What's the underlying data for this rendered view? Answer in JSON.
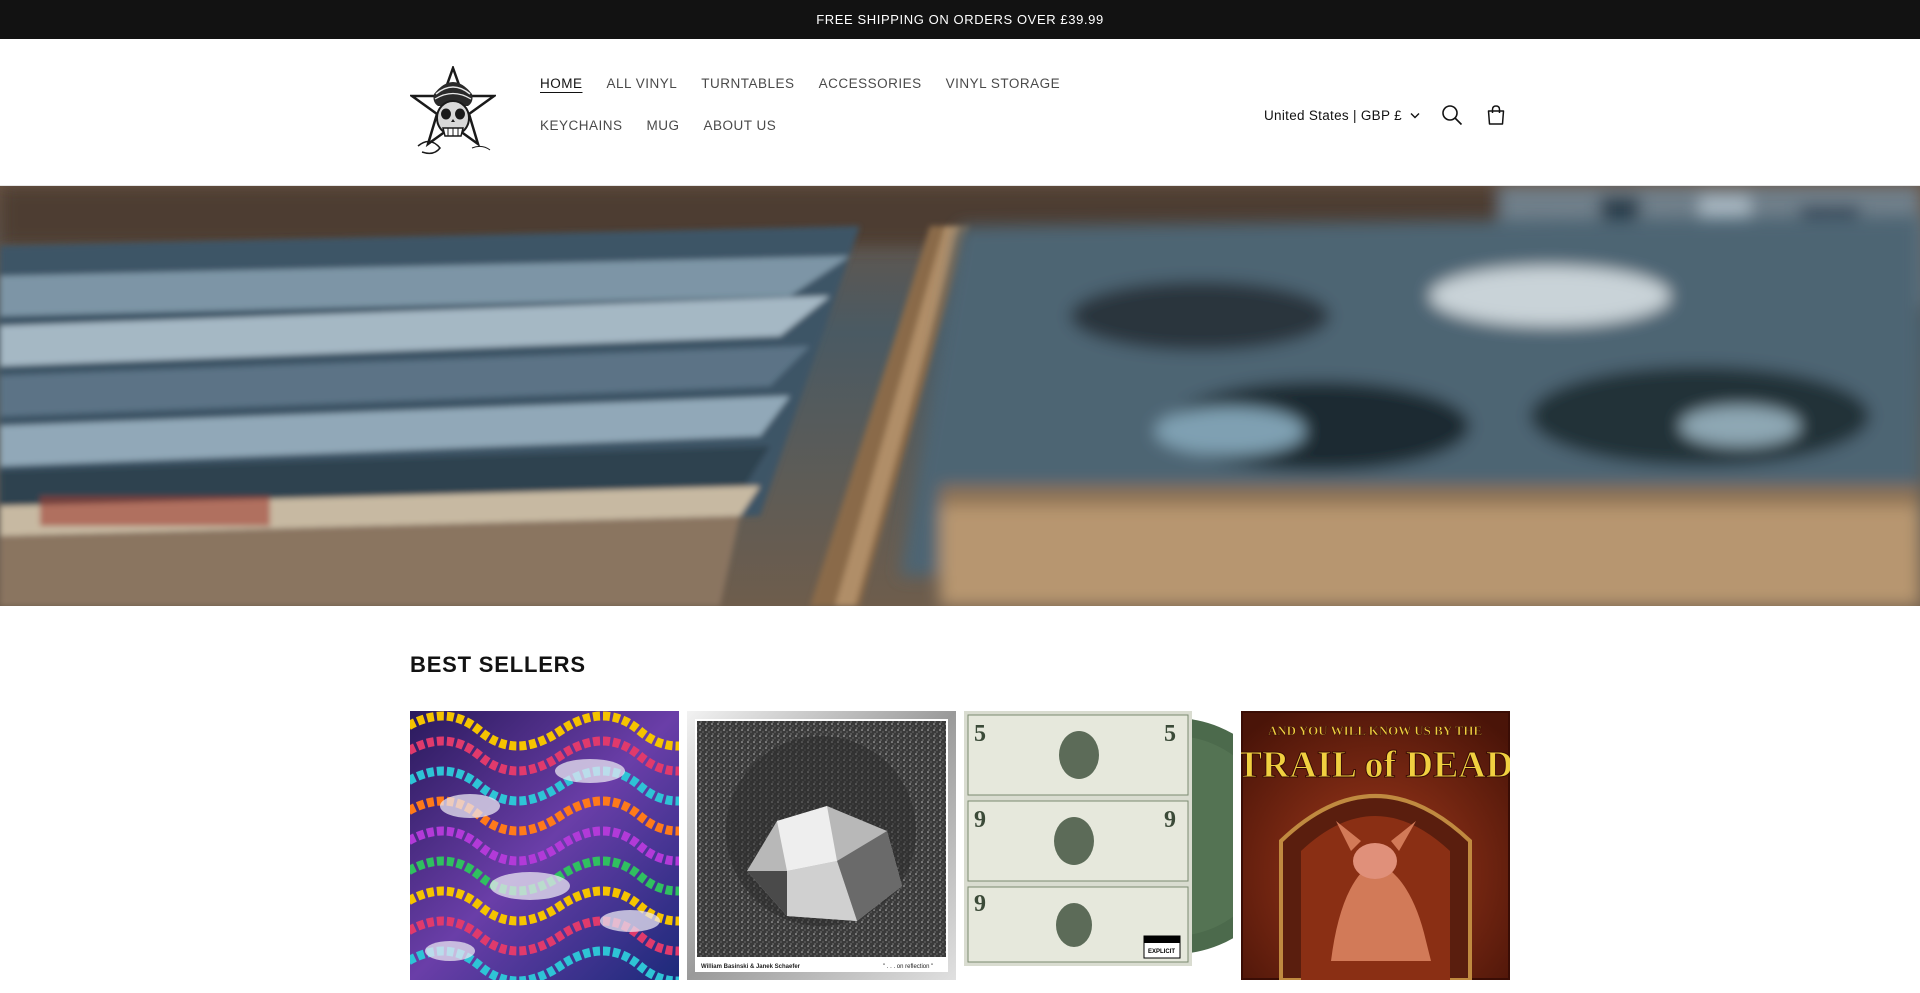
{
  "announcement": {
    "text": "FREE SHIPPING ON ORDERS OVER £39.99"
  },
  "nav": {
    "items": [
      {
        "label": "HOME",
        "active": true
      },
      {
        "label": "ALL VINYL"
      },
      {
        "label": "TURNTABLES"
      },
      {
        "label": "ACCESSORIES"
      },
      {
        "label": "VINYL STORAGE"
      },
      {
        "label": "KEYCHAINS"
      },
      {
        "label": "MUG"
      },
      {
        "label": "ABOUT US"
      }
    ]
  },
  "header": {
    "country_selector": "United States | GBP £",
    "icons": [
      "search-icon",
      "cart-icon",
      "chevron-down-icon"
    ]
  },
  "hero": {
    "image": "record-crates-photo"
  },
  "best_sellers": {
    "title": "BEST SELLERS",
    "products": [
      {
        "image": "psychedelic-mosaic-cover"
      },
      {
        "image": "silver-foil-cover",
        "cover_text_left": "William Basinski & Janek Schaefer",
        "cover_text_right": "\" . . . on reflection \""
      },
      {
        "image": "dollar-bills-cover",
        "badge": "PARENTAL ADVISORY EXPLICIT CONTENT"
      },
      {
        "image": "trail-of-dead-cover",
        "cover_title": "AND YOU WILL KNOW US BY THE TRAIL of DEAD"
      }
    ]
  },
  "colors": {
    "announcement_bg": "#121212",
    "text": "#121212",
    "nav_text": "#4a4a4a"
  }
}
